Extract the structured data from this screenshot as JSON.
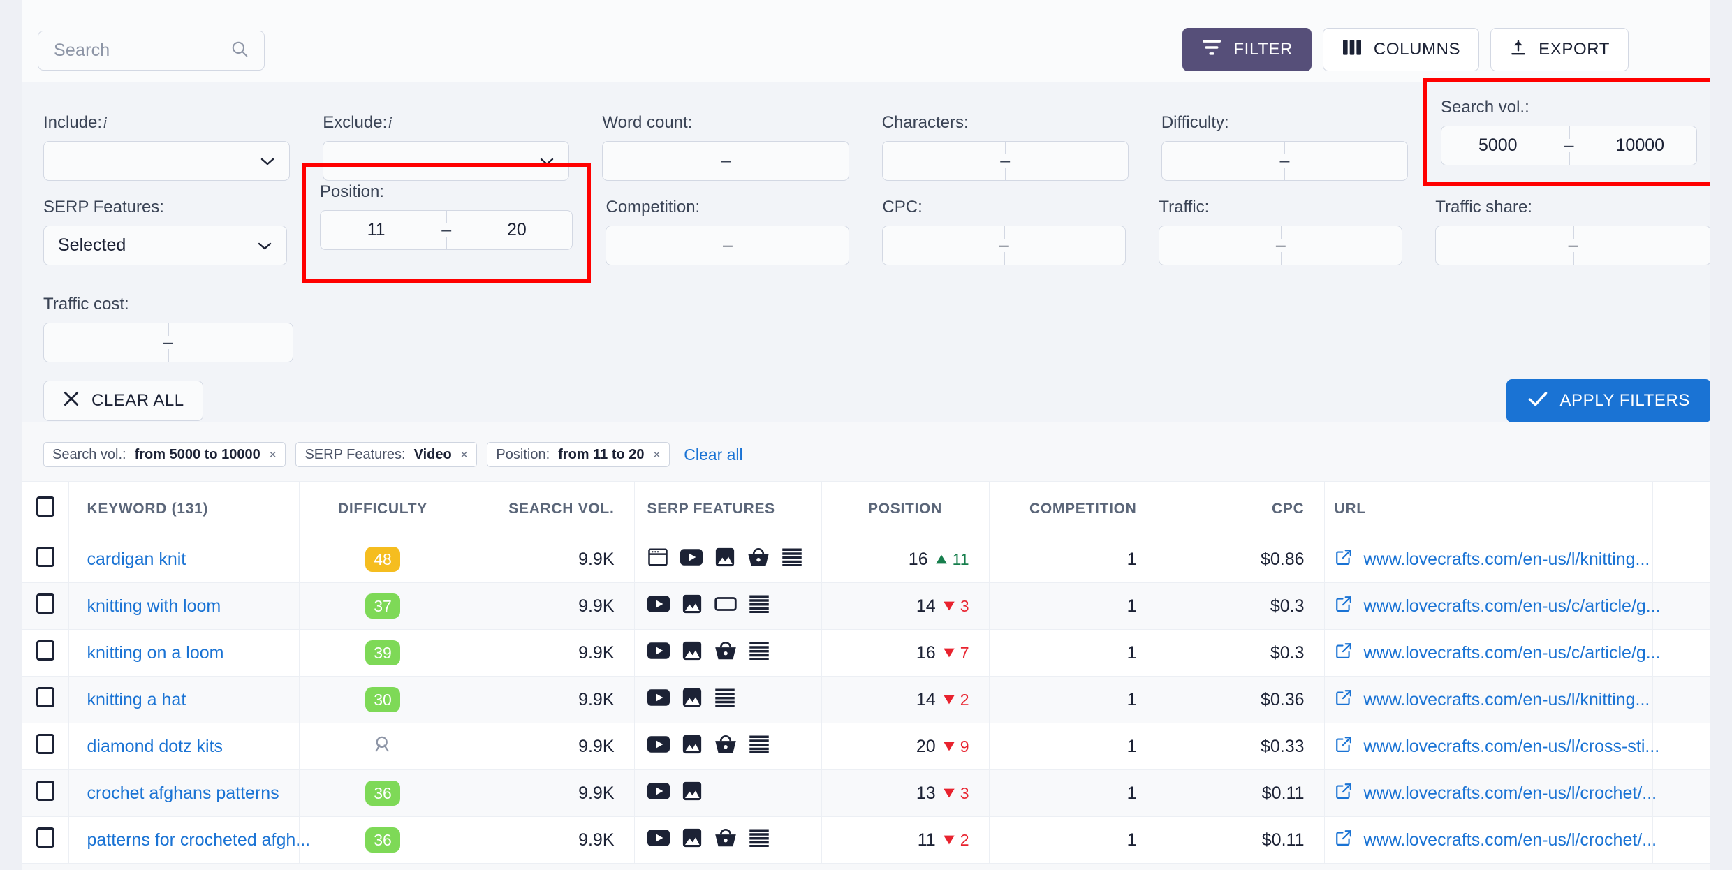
{
  "topbar": {
    "search_placeholder": "Search",
    "search_value": "",
    "buttons": {
      "filter": "FILTER",
      "columns": "COLUMNS",
      "export": "EXPORT"
    }
  },
  "filters": {
    "row1": [
      {
        "label": "Include:",
        "info": "i",
        "type": "select",
        "value": ""
      },
      {
        "label": "Exclude:",
        "info": "i",
        "type": "select",
        "value": ""
      },
      {
        "label": "Word count:",
        "type": "range",
        "from": "",
        "to": "",
        "dash": "–"
      },
      {
        "label": "Characters:",
        "type": "range",
        "from": "",
        "to": "",
        "dash": "–"
      },
      {
        "label": "Difficulty:",
        "type": "range",
        "from": "",
        "to": "",
        "dash": "–"
      },
      {
        "label": "Search vol.:",
        "type": "range",
        "from": "5000",
        "to": "10000",
        "dash": "–",
        "highlighted": true
      }
    ],
    "row2": [
      {
        "label": "SERP Features:",
        "type": "select",
        "value": "Selected"
      },
      {
        "label": "Position:",
        "type": "range",
        "from": "11",
        "to": "20",
        "dash": "–",
        "highlighted": true
      },
      {
        "label": "Competition:",
        "type": "range",
        "from": "",
        "to": "",
        "dash": "–"
      },
      {
        "label": "CPC:",
        "type": "range",
        "from": "",
        "to": "",
        "dash": "–"
      },
      {
        "label": "Traffic:",
        "type": "range",
        "from": "",
        "to": "",
        "dash": "–"
      },
      {
        "label": "Traffic share:",
        "type": "range",
        "from": "",
        "to": "",
        "dash": "–"
      }
    ],
    "row3": [
      {
        "label": "Traffic cost:",
        "type": "range",
        "from": "",
        "to": "",
        "dash": "–"
      }
    ],
    "clear_all_label": "CLEAR ALL",
    "apply_label": "APPLY FILTERS"
  },
  "chips": {
    "items": [
      {
        "title": "Search vol.:",
        "value": "from 5000 to 10000",
        "close": "✕"
      },
      {
        "title": "SERP Features:",
        "value": "Video",
        "close": "✕"
      },
      {
        "title": "Position:",
        "value": "from 11 to 20",
        "close": "✕"
      }
    ],
    "clear_all": "Clear all"
  },
  "table": {
    "headers": {
      "keyword": "KEYWORD  (131)",
      "difficulty": "DIFFICULTY",
      "search_vol": "SEARCH VOL.",
      "serp_features": "SERP FEATURES",
      "position": "POSITION",
      "competition": "COMPETITION",
      "cpc": "CPC",
      "url": "URL"
    },
    "colors": {
      "difficulty_yellow": "#f5bd1f",
      "difficulty_green": "#7ed957",
      "link_blue": "#1a73d4",
      "delta_up": "#167e4c",
      "delta_down": "#e8222e"
    },
    "rows": [
      {
        "keyword": "cardigan knit",
        "difficulty": "48",
        "difficulty_color": "#f5bd1f",
        "search_vol": "9.9K",
        "serp": [
          "featured-snippet-icon",
          "video-icon",
          "image-icon",
          "shopping-icon",
          "reviews-icon"
        ],
        "position": "16",
        "delta": "11",
        "delta_dir": "up",
        "competition": "1",
        "cpc": "$0.86",
        "url": "www.lovecrafts.com/en-us/l/knitting..."
      },
      {
        "keyword": "knitting with loom",
        "difficulty": "37",
        "difficulty_color": "#7ed957",
        "search_vol": "9.9K",
        "serp": [
          "video-icon",
          "image-icon",
          "knowledge-panel-icon",
          "reviews-icon"
        ],
        "position": "14",
        "delta": "3",
        "delta_dir": "down",
        "competition": "1",
        "cpc": "$0.3",
        "url": "www.lovecrafts.com/en-us/c/article/g..."
      },
      {
        "keyword": "knitting on a loom",
        "difficulty": "39",
        "difficulty_color": "#7ed957",
        "search_vol": "9.9K",
        "serp": [
          "video-icon",
          "image-icon",
          "shopping-icon",
          "reviews-icon"
        ],
        "position": "16",
        "delta": "7",
        "delta_dir": "down",
        "competition": "1",
        "cpc": "$0.3",
        "url": "www.lovecrafts.com/en-us/c/article/g..."
      },
      {
        "keyword": "knitting a hat",
        "difficulty": "30",
        "difficulty_color": "#7ed957",
        "search_vol": "9.9K",
        "serp": [
          "video-icon",
          "image-icon",
          "reviews-icon"
        ],
        "position": "14",
        "delta": "2",
        "delta_dir": "down",
        "competition": "1",
        "cpc": "$0.36",
        "url": "www.lovecrafts.com/en-us/l/knitting..."
      },
      {
        "keyword": "diamond dotz kits",
        "difficulty": "",
        "difficulty_color": "",
        "difficulty_icon": "magnifier-icon",
        "search_vol": "9.9K",
        "serp": [
          "video-icon",
          "image-icon",
          "shopping-icon",
          "reviews-icon"
        ],
        "position": "20",
        "delta": "9",
        "delta_dir": "down",
        "competition": "1",
        "cpc": "$0.33",
        "url": "www.lovecrafts.com/en-us/l/cross-sti..."
      },
      {
        "keyword": "crochet afghans patterns",
        "difficulty": "36",
        "difficulty_color": "#7ed957",
        "search_vol": "9.9K",
        "serp": [
          "video-icon",
          "image-icon"
        ],
        "position": "13",
        "delta": "3",
        "delta_dir": "down",
        "competition": "1",
        "cpc": "$0.11",
        "url": "www.lovecrafts.com/en-us/l/crochet/..."
      },
      {
        "keyword": "patterns for crocheted afgh...",
        "difficulty": "36",
        "difficulty_color": "#7ed957",
        "search_vol": "9.9K",
        "serp": [
          "video-icon",
          "image-icon",
          "shopping-icon",
          "reviews-icon"
        ],
        "position": "11",
        "delta": "2",
        "delta_dir": "down",
        "competition": "1",
        "cpc": "$0.11",
        "url": "www.lovecrafts.com/en-us/l/crochet/..."
      }
    ]
  }
}
